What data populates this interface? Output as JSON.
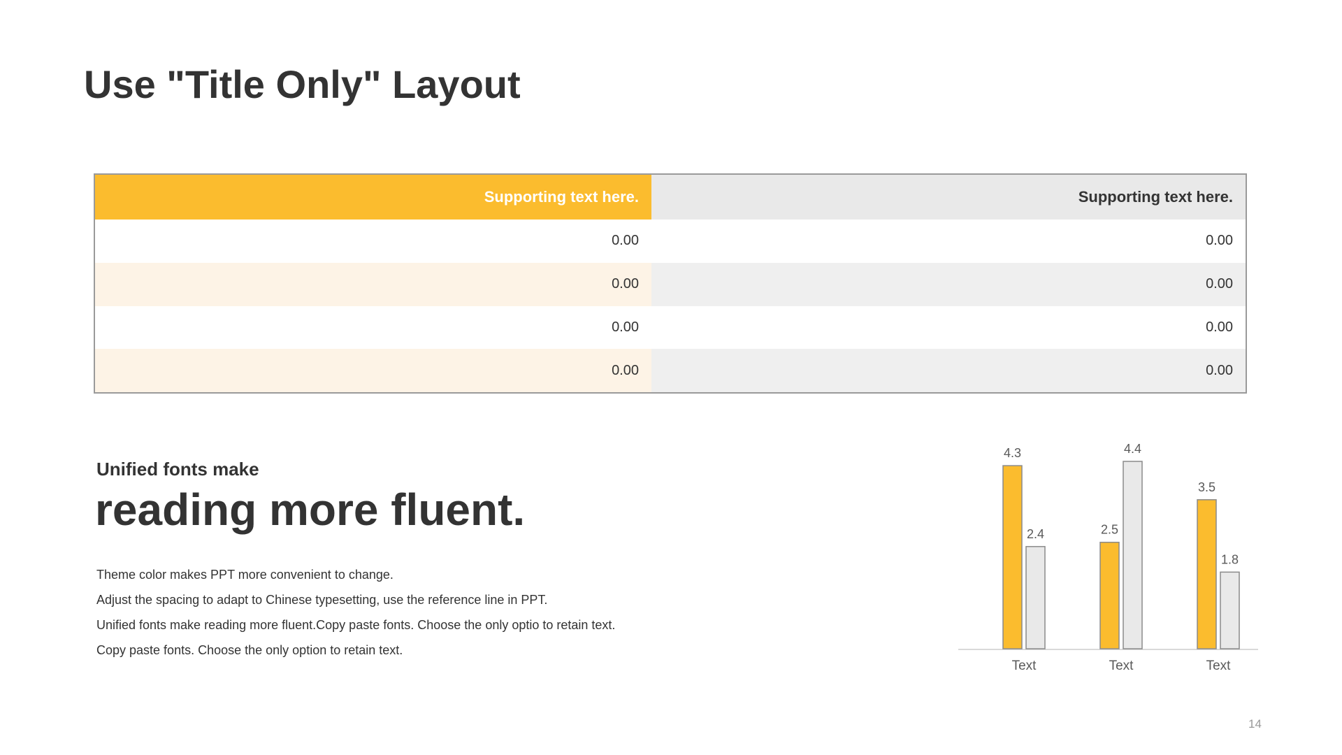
{
  "slide": {
    "title": "Use \"Title Only\" Layout",
    "page_number": "14"
  },
  "table": {
    "headers": [
      "Supporting text here.",
      "Supporting text here."
    ],
    "rows": [
      [
        "0.00",
        "0.00"
      ],
      [
        "0.00",
        "0.00"
      ],
      [
        "0.00",
        "0.00"
      ],
      [
        "0.00",
        "0.00"
      ]
    ]
  },
  "text_block": {
    "subheading": "Unified fonts make",
    "headline": "reading more fluent.",
    "lines": [
      "Theme color makes PPT more convenient  to change.",
      "Adjust the spacing to adapt to Chinese  typesetting, use  the reference line  in  PPT.",
      "Unified  fonts make reading more fluent.Copy paste fonts. Choose the only optio to retain text.",
      "Copy paste  fonts. Choose the only option to retain text."
    ]
  },
  "colors": {
    "accent": "#fbbc2e",
    "secondary": "#e9e9e9",
    "text": "#333333"
  },
  "chart_data": {
    "type": "bar",
    "categories": [
      "Text",
      "Text",
      "Text"
    ],
    "series": [
      {
        "values": [
          4.3,
          2.5,
          3.5
        ],
        "color": "#fbbc2e"
      },
      {
        "values": [
          2.4,
          4.4,
          1.8
        ],
        "color": "#e9e9e9"
      }
    ],
    "ylim": [
      0,
      4.4
    ],
    "grid": false,
    "legend": "none"
  }
}
